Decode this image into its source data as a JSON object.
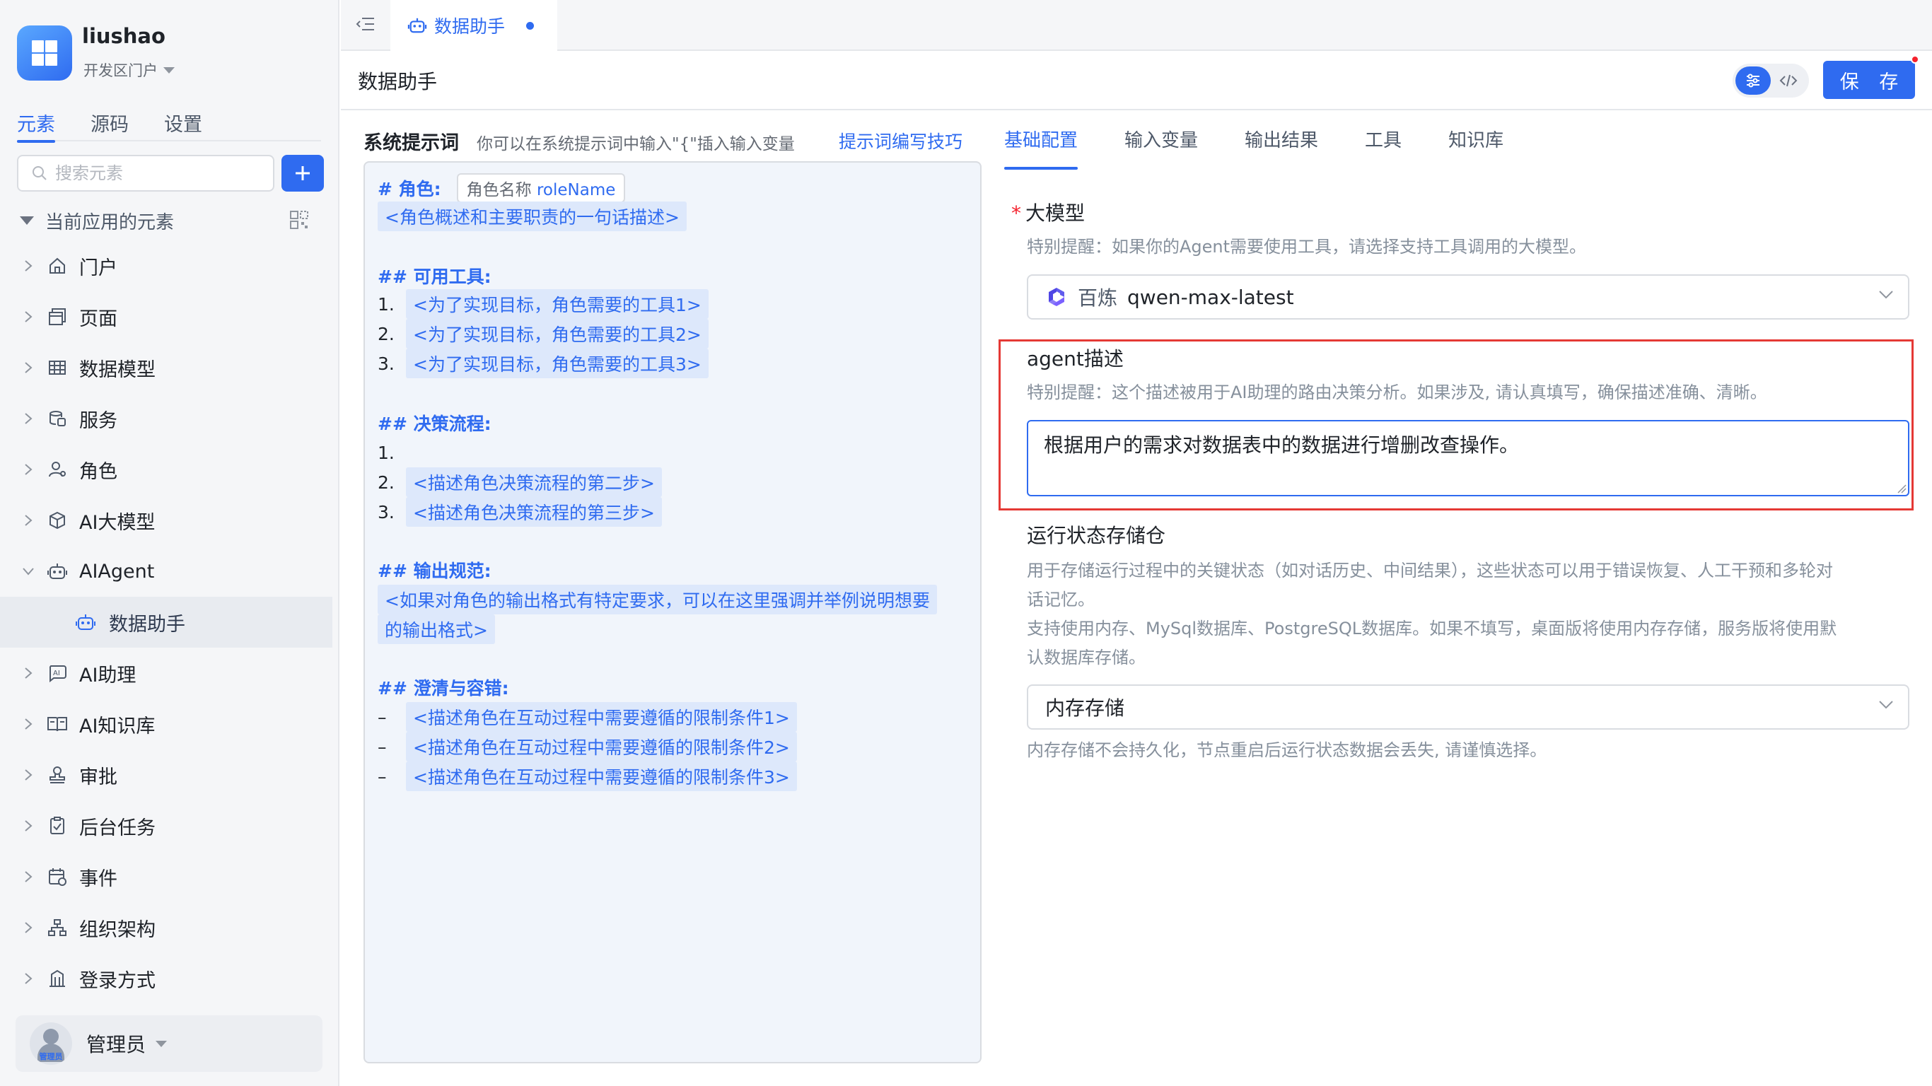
{
  "sidebar": {
    "user_name": "liushao",
    "env_label": "开发区门户",
    "tabs": [
      {
        "label": "元素",
        "active": true
      },
      {
        "label": "源码",
        "active": false
      },
      {
        "label": "设置",
        "active": false
      }
    ],
    "search_placeholder": "搜索元素",
    "tree_header": "当前应用的元素",
    "items": [
      {
        "label": "门户",
        "icon": "home-icon"
      },
      {
        "label": "页面",
        "icon": "page-icon"
      },
      {
        "label": "数据模型",
        "icon": "table-icon"
      },
      {
        "label": "服务",
        "icon": "service-icon"
      },
      {
        "label": "角色",
        "icon": "role-icon"
      },
      {
        "label": "AI大模型",
        "icon": "cube-icon"
      },
      {
        "label": "AIAgent",
        "icon": "robot-icon",
        "expanded": true
      },
      {
        "label": "数据助手",
        "icon": "robot-icon",
        "child": true,
        "selected": true
      },
      {
        "label": "AI助理",
        "icon": "ai-assistant-icon"
      },
      {
        "label": "AI知识库",
        "icon": "book-icon"
      },
      {
        "label": "审批",
        "icon": "stamp-icon"
      },
      {
        "label": "后台任务",
        "icon": "clipboard-check-icon"
      },
      {
        "label": "事件",
        "icon": "calendar-icon"
      },
      {
        "label": "组织架构",
        "icon": "org-chart-icon"
      },
      {
        "label": "登录方式",
        "icon": "building-icon"
      }
    ],
    "admin": {
      "name": "管理员",
      "avatar_tag": "管理员"
    }
  },
  "topbar": {
    "tab_label": "数据助手"
  },
  "header": {
    "title": "数据助手",
    "save_label": "保 存"
  },
  "prompt": {
    "title": "系统提示词",
    "hint": "你可以在系统提示词中输入\"{\"插入输入变量",
    "tips_link": "提示词编写技巧",
    "role_heading": "# 角色:",
    "role_pill_cn": "角色名称",
    "role_pill_en": "roleName",
    "role_desc": "<角色概述和主要职责的一句话描述>",
    "tools_heading": "## 可用工具:",
    "tools": [
      {
        "num": "1.",
        "text": "<为了实现目标，角色需要的工具1>"
      },
      {
        "num": "2.",
        "text": "<为了实现目标，角色需要的工具2>"
      },
      {
        "num": "3.",
        "text": "<为了实现目标，角色需要的工具3>"
      }
    ],
    "flow_heading": "## 决策流程:",
    "flow": [
      {
        "num": "1.",
        "text": ""
      },
      {
        "num": "2.",
        "text": "<描述角色决策流程的第二步>"
      },
      {
        "num": "3.",
        "text": "<描述角色决策流程的第三步>"
      }
    ],
    "output_heading": "## 输出规范:",
    "output_line1": "<如果对角色的输出格式有特定要求，可以在这里强调并举例说明想要",
    "output_line2": "的输出格式>",
    "clarify_heading": "## 澄清与容错:",
    "clarify": [
      {
        "num": "–",
        "text": "<描述角色在互动过程中需要遵循的限制条件1>"
      },
      {
        "num": "–",
        "text": "<描述角色在互动过程中需要遵循的限制条件2>"
      },
      {
        "num": "–",
        "text": "<描述角色在互动过程中需要遵循的限制条件3>"
      }
    ]
  },
  "config": {
    "tabs": [
      {
        "label": "基础配置",
        "active": true
      },
      {
        "label": "输入变量",
        "active": false
      },
      {
        "label": "输出结果",
        "active": false
      },
      {
        "label": "工具",
        "active": false
      },
      {
        "label": "知识库",
        "active": false
      }
    ],
    "model": {
      "title": "大模型",
      "required_mark": "*",
      "hint": "特别提醒：如果你的Agent需要使用工具，请选择支持工具调用的大模型。",
      "provider": "百炼",
      "value": "qwen-max-latest"
    },
    "agent_desc": {
      "title": "agent描述",
      "hint": "特别提醒：这个描述被用于AI助理的路由决策分析。如果涉及, 请认真填写，确保描述准确、清晰。",
      "value": "根据用户的需求对数据表中的数据进行增删改查操作。"
    },
    "storage": {
      "title": "运行状态存储仓",
      "desc_line1": "用于存储运行过程中的关键状态（如对话历史、中间结果），这些状态可以用于错误恢复、人工干预和多轮对",
      "desc_line2": "话记忆。",
      "desc_line3": "支持使用内存、MySql数据库、PostgreSQL数据库。如果不填写，桌面版将使用内存存储，服务版将使用默",
      "desc_line4": "认数据库存储。",
      "value": "内存存储",
      "footnote": "内存存储不会持久化，节点重启后运行状态数据会丢失, 请谨慎选择。"
    }
  },
  "colors": {
    "accent": "#2f6bf0",
    "highlight_border": "#e53935",
    "required": "#f5222d"
  }
}
